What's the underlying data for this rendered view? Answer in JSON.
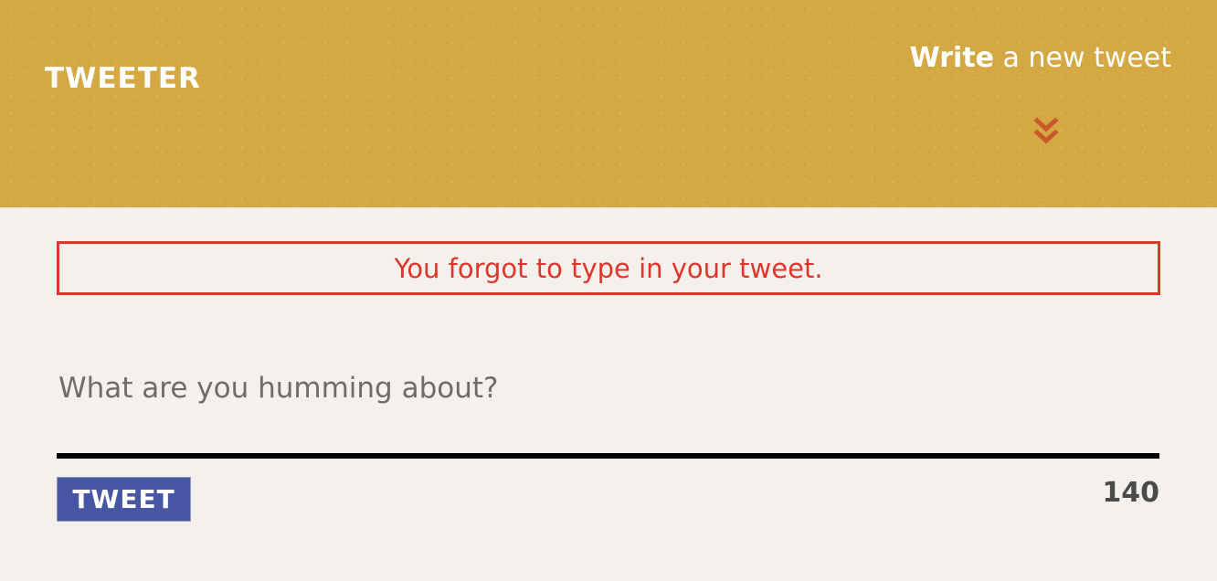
{
  "colors": {
    "header_background": "#d4a843",
    "page_background": "#f4f1ed",
    "error": "#e0352b",
    "button": "#4656a2",
    "chevron": "#c9592b"
  },
  "header": {
    "logo": "TWEETER",
    "compose_bold": "Write",
    "compose_rest": " a new tweet",
    "toggle_icon": "double-chevron-down-icon"
  },
  "error": {
    "message": "You forgot to type in your tweet."
  },
  "composer": {
    "value": "",
    "placeholder": "What are you humming about?",
    "submit_label": "TWEET",
    "counter": "140"
  }
}
